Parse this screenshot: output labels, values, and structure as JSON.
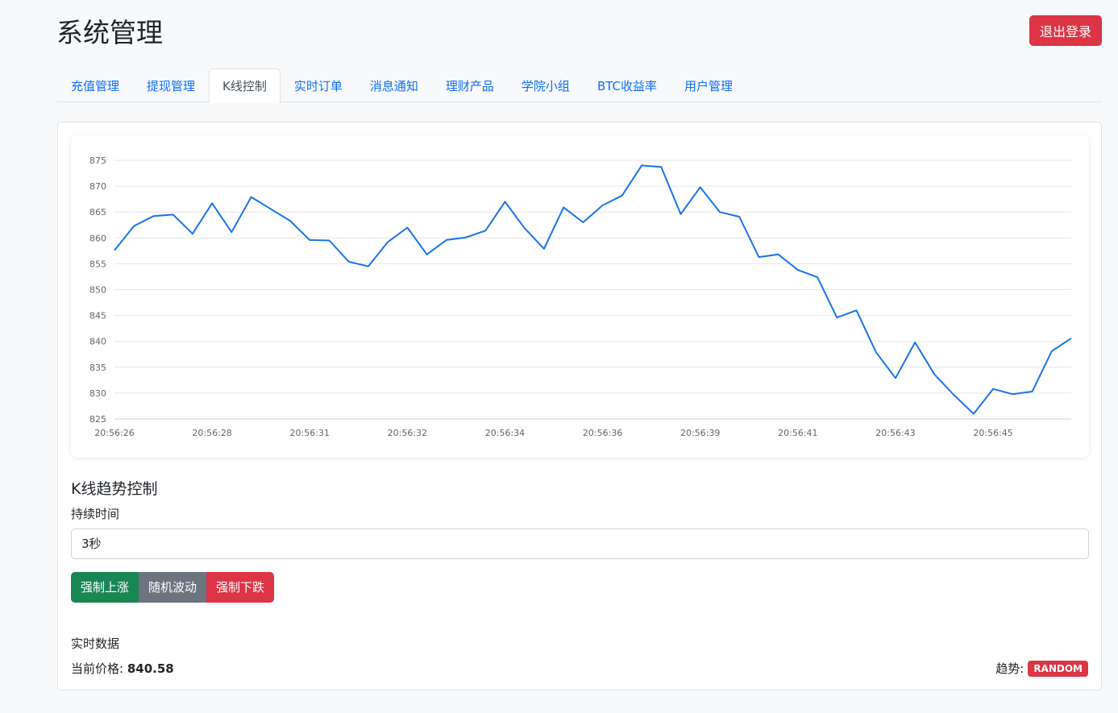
{
  "header": {
    "title": "系统管理",
    "logout_label": "退出登录"
  },
  "tabs": [
    {
      "label": "充值管理",
      "active": false
    },
    {
      "label": "提现管理",
      "active": false
    },
    {
      "label": "K线控制",
      "active": true
    },
    {
      "label": "实时订单",
      "active": false
    },
    {
      "label": "消息通知",
      "active": false
    },
    {
      "label": "理财产品",
      "active": false
    },
    {
      "label": "学院小组",
      "active": false
    },
    {
      "label": "BTC收益率",
      "active": false
    },
    {
      "label": "用户管理",
      "active": false
    }
  ],
  "chart_data": {
    "type": "line",
    "title": "",
    "xlabel": "",
    "ylabel": "",
    "ylim": [
      825,
      875
    ],
    "yticks": [
      825,
      830,
      835,
      840,
      845,
      850,
      855,
      860,
      865,
      870,
      875
    ],
    "xtick_labels": [
      "20:56:26",
      "20:56:28",
      "20:56:31",
      "20:56:32",
      "20:56:34",
      "20:56:36",
      "20:56:39",
      "20:56:41",
      "20:56:43",
      "20:56:45"
    ],
    "grid": true,
    "line_color": "#1a73e8",
    "series": [
      {
        "values": [
          857.6,
          862.3,
          864.2,
          864.5,
          860.8,
          866.7,
          861.1,
          867.9,
          865.6,
          863.3,
          859.6,
          859.5,
          855.4,
          854.5,
          859.2,
          862.0,
          856.8,
          859.6,
          860.1,
          861.4,
          867.0,
          861.9,
          857.9,
          865.9,
          863.0,
          866.3,
          868.2,
          874.0,
          873.7,
          864.6,
          869.8,
          865.0,
          864.1,
          856.3,
          856.8,
          853.8,
          852.4,
          844.6,
          846.0,
          837.9,
          832.9,
          839.8,
          833.6,
          829.6,
          826.0,
          830.8,
          829.8,
          830.3,
          838.1,
          840.6
        ]
      }
    ]
  },
  "control": {
    "section_title": "K线趋势控制",
    "duration_label": "持续时间",
    "duration_value": "3秒",
    "buttons": {
      "up": "强制上涨",
      "random": "随机波动",
      "down": "强制下跌"
    }
  },
  "realtime": {
    "title": "实时数据",
    "price_label": "当前价格:",
    "price_value": "840.58",
    "trend_label": "趋势:",
    "trend_value": "RANDOM"
  }
}
